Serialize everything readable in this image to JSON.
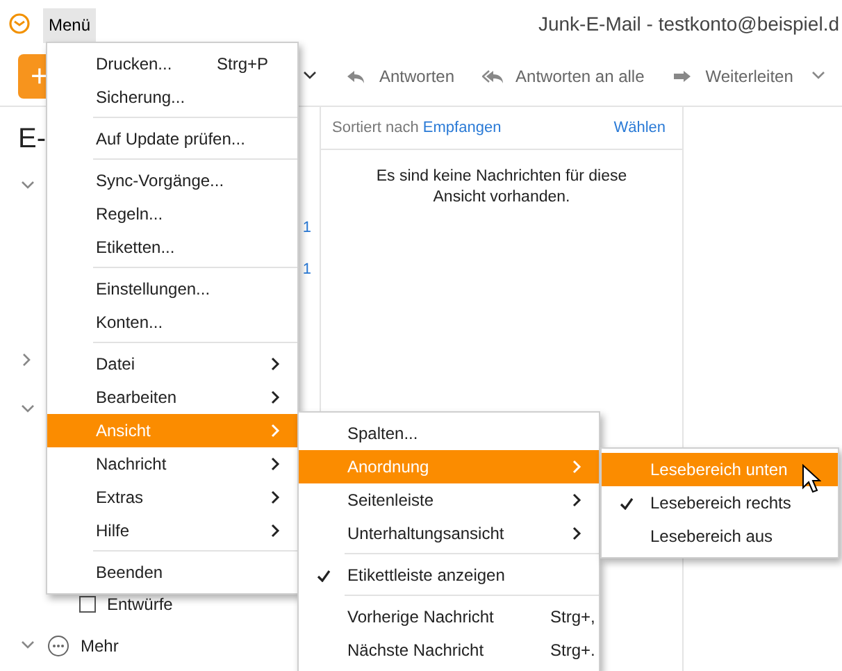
{
  "titlebar": {
    "menu_button": "Menü",
    "title": "Junk-E-Mail - testkonto@beispiel.d"
  },
  "toolbar": {
    "compose_label": "+",
    "actions": [
      {
        "kind": "reply",
        "label": "Antworten"
      },
      {
        "kind": "reply_all",
        "label": "Antworten an alle"
      },
      {
        "kind": "forward",
        "label": "Weiterleiten"
      }
    ]
  },
  "sidebar": {
    "heading": "E-",
    "items": [
      {
        "kind": "group",
        "expanded": true
      },
      {
        "kind": "count",
        "count": "1"
      },
      {
        "kind": "count",
        "count": "1"
      },
      {
        "kind": "group",
        "expanded": false
      },
      {
        "kind": "group",
        "expanded": true
      },
      {
        "kind": "folder",
        "label": "Entwürfe"
      },
      {
        "kind": "more",
        "expanded": true,
        "label": "Mehr"
      }
    ]
  },
  "message_list": {
    "sort_label": "Sortiert nach",
    "sort_value": "Empfangen",
    "select_link": "Wählen",
    "empty_text": "Es sind keine Nachrichten für diese Ansicht vorhanden."
  },
  "menus": [
    {
      "items": [
        {
          "label": "Drucken...",
          "shortcut": "Strg+P",
          "submenu": false,
          "selected": false,
          "checked": false,
          "separator_before": false
        },
        {
          "label": "Sicherung...",
          "submenu": false,
          "selected": false,
          "checked": false,
          "separator_before": false
        },
        {
          "label": "Auf Update prüfen...",
          "submenu": false,
          "selected": false,
          "checked": false,
          "separator_before": true
        },
        {
          "label": "Sync-Vorgänge...",
          "submenu": false,
          "selected": false,
          "checked": false,
          "separator_before": true
        },
        {
          "label": "Regeln...",
          "submenu": false,
          "selected": false,
          "checked": false,
          "separator_before": false
        },
        {
          "label": "Etiketten...",
          "submenu": false,
          "selected": false,
          "checked": false,
          "separator_before": false
        },
        {
          "label": "Einstellungen...",
          "submenu": false,
          "selected": false,
          "checked": false,
          "separator_before": true
        },
        {
          "label": "Konten...",
          "submenu": false,
          "selected": false,
          "checked": false,
          "separator_before": false
        },
        {
          "label": "Datei",
          "submenu": true,
          "selected": false,
          "checked": false,
          "separator_before": true
        },
        {
          "label": "Bearbeiten",
          "submenu": true,
          "selected": false,
          "checked": false,
          "separator_before": false
        },
        {
          "label": "Ansicht",
          "submenu": true,
          "selected": true,
          "checked": false,
          "separator_before": false
        },
        {
          "label": "Nachricht",
          "submenu": true,
          "selected": false,
          "checked": false,
          "separator_before": false
        },
        {
          "label": "Extras",
          "submenu": true,
          "selected": false,
          "checked": false,
          "separator_before": false
        },
        {
          "label": "Hilfe",
          "submenu": true,
          "selected": false,
          "checked": false,
          "separator_before": false
        },
        {
          "label": "Beenden",
          "submenu": false,
          "selected": false,
          "checked": false,
          "separator_before": true
        }
      ]
    },
    {
      "items": [
        {
          "label": "Spalten...",
          "submenu": false,
          "selected": false,
          "checked": false,
          "separator_before": false
        },
        {
          "label": "Anordnung",
          "submenu": true,
          "selected": true,
          "checked": false,
          "separator_before": false
        },
        {
          "label": "Seitenleiste",
          "submenu": true,
          "selected": false,
          "checked": false,
          "separator_before": false
        },
        {
          "label": "Unterhaltungsansicht",
          "submenu": true,
          "selected": false,
          "checked": false,
          "separator_before": false
        },
        {
          "label": "Etikettleiste anzeigen",
          "submenu": false,
          "selected": false,
          "checked": true,
          "separator_before": true
        },
        {
          "label": "Vorherige Nachricht",
          "shortcut": "Strg+,",
          "submenu": false,
          "selected": false,
          "checked": false,
          "separator_before": true
        },
        {
          "label": "Nächste Nachricht",
          "shortcut": "Strg+.",
          "submenu": false,
          "selected": false,
          "checked": false,
          "separator_before": false
        }
      ]
    },
    {
      "items": [
        {
          "label": "Lesebereich unten",
          "submenu": false,
          "selected": true,
          "checked": false,
          "separator_before": false
        },
        {
          "label": "Lesebereich rechts",
          "submenu": false,
          "selected": false,
          "checked": true,
          "separator_before": false
        },
        {
          "label": "Lesebereich aus",
          "submenu": false,
          "selected": false,
          "checked": false,
          "separator_before": false
        }
      ]
    }
  ]
}
